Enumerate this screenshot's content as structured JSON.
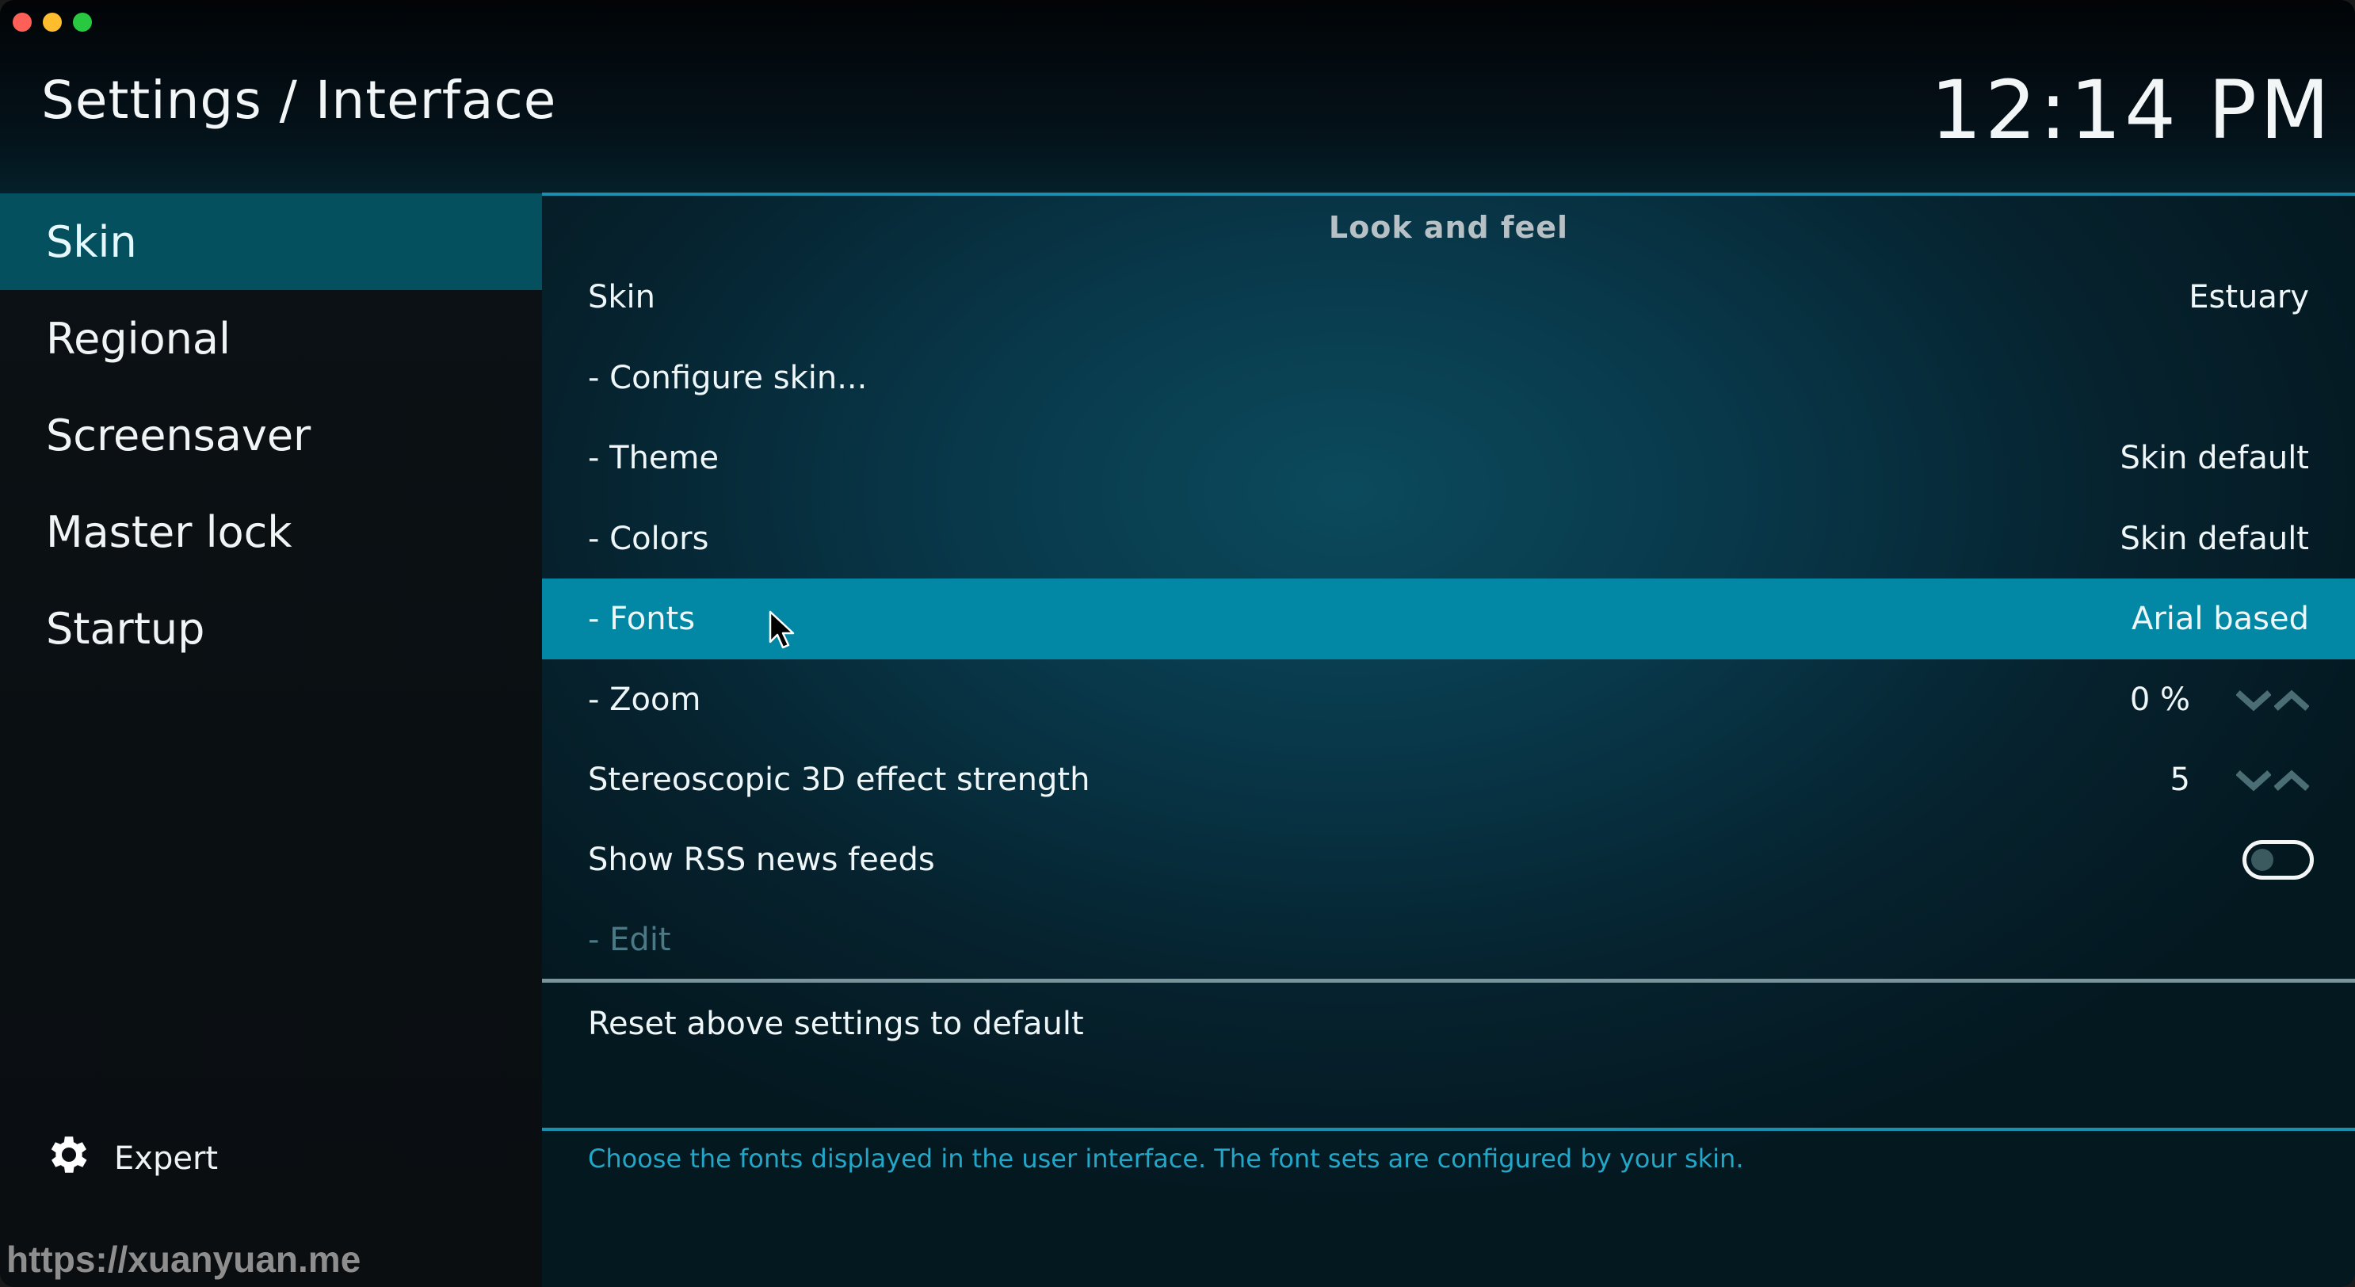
{
  "window": {
    "title": "Settings / Interface",
    "clock": "12:14 PM"
  },
  "sidebar": {
    "items": [
      {
        "label": "Skin",
        "active": true
      },
      {
        "label": "Regional",
        "active": false
      },
      {
        "label": "Screensaver",
        "active": false
      },
      {
        "label": "Master lock",
        "active": false
      },
      {
        "label": "Startup",
        "active": false
      }
    ],
    "settings_level": {
      "icon": "gear-icon",
      "label": "Expert"
    }
  },
  "main": {
    "section_title": "Look and feel",
    "settings": [
      {
        "label": "Skin",
        "value": "Estuary"
      },
      {
        "label": "- Configure skin...",
        "value": ""
      },
      {
        "label": "- Theme",
        "value": "Skin default"
      },
      {
        "label": "- Colors",
        "value": "Skin default"
      },
      {
        "label": "- Fonts",
        "value": "Arial based",
        "focused": true
      },
      {
        "label": "- Zoom",
        "value": "0 %",
        "control": "spinner"
      },
      {
        "label": "Stereoscopic 3D effect strength",
        "value": "5",
        "control": "spinner"
      },
      {
        "label": "Show RSS news feeds",
        "value": "off",
        "control": "toggle"
      },
      {
        "label": "- Edit",
        "value": "",
        "disabled": true
      }
    ],
    "reset_label": "Reset above settings to default",
    "help_text": "Choose the fonts displayed in the user interface. The font sets are configured by your skin."
  },
  "watermark": "https://xuanyuan.me",
  "colors": {
    "accent": "#0288a4",
    "sidebar_active": "#04505e",
    "help_text": "#22a7c8",
    "divider": "#1a8fae"
  }
}
